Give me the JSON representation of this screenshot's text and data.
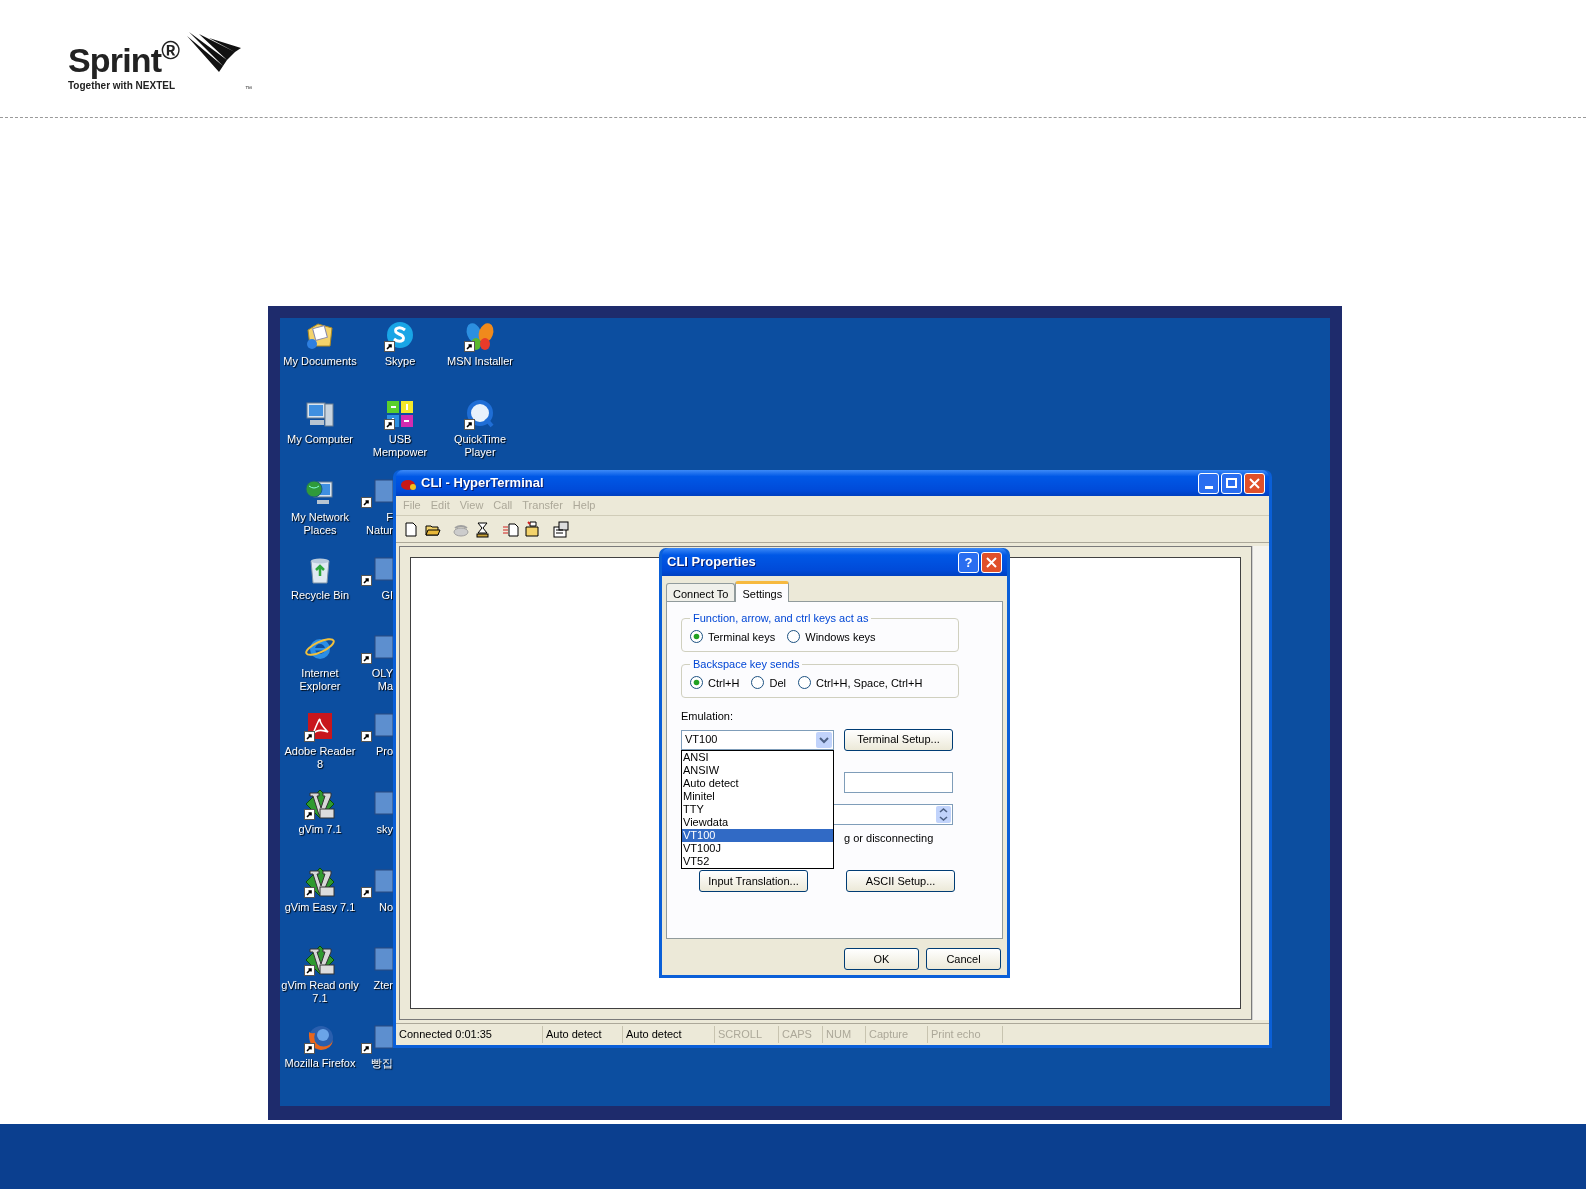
{
  "logo": {
    "name": "Sprint$^{®}$",
    "tagline": "Together with NEXTEL",
    "tm": "™"
  },
  "desktop": {
    "columns": [
      {
        "icons": [
          {
            "kind": "documents",
            "label": "My Documents",
            "shortcut": false
          },
          {
            "kind": "computer",
            "label": "My Computer",
            "shortcut": false
          },
          {
            "kind": "network",
            "label": "My Network Places",
            "shortcut": false
          },
          {
            "kind": "recycle",
            "label": "Recycle Bin",
            "shortcut": false
          },
          {
            "kind": "ie",
            "label": "Internet Explorer",
            "shortcut": false
          },
          {
            "kind": "adobe",
            "label": "Adobe Reader 8",
            "shortcut": true
          },
          {
            "kind": "vim",
            "label": "gVim 7.1",
            "shortcut": true
          },
          {
            "kind": "vim",
            "label": "gVim Easy 7.1",
            "shortcut": true
          },
          {
            "kind": "vim",
            "label": "gVim Read only 7.1",
            "shortcut": true
          },
          {
            "kind": "firefox",
            "label": "Mozilla Firefox",
            "shortcut": true
          }
        ]
      },
      {
        "icons": [
          {
            "kind": "skype",
            "label": "Skype",
            "shortcut": true
          },
          {
            "kind": "usb",
            "label": "USB Mempower",
            "shortcut": true
          },
          {
            "kind": "partial",
            "label": "F Natur",
            "shortcut": true
          },
          {
            "kind": "partial",
            "label": "GI",
            "shortcut": true
          },
          {
            "kind": "partial",
            "label": "OLY Ma",
            "shortcut": true
          },
          {
            "kind": "partial",
            "label": "Pro",
            "shortcut": true
          },
          {
            "kind": "partial",
            "label": "sky",
            "shortcut": false
          },
          {
            "kind": "partial",
            "label": "No",
            "shortcut": true
          },
          {
            "kind": "partial",
            "label": "Zter",
            "shortcut": false
          },
          {
            "kind": "partial",
            "label": "빵집",
            "shortcut": true
          }
        ]
      },
      {
        "icons": [
          {
            "kind": "msn",
            "label": "MSN Installer",
            "shortcut": true
          },
          {
            "kind": "quicktime",
            "label": "QuickTime Player",
            "shortcut": true
          }
        ]
      }
    ]
  },
  "window": {
    "title": "CLI - HyperTerminal",
    "menu": [
      {
        "label": "File",
        "disabled": true
      },
      {
        "label": "Edit",
        "disabled": true
      },
      {
        "label": "View",
        "disabled": true
      },
      {
        "label": "Call",
        "disabled": true
      },
      {
        "label": "Transfer",
        "disabled": true
      },
      {
        "label": "Help",
        "disabled": true
      }
    ],
    "toolbar": [
      {
        "disabled": false
      },
      {
        "disabled": false
      },
      {
        "disabled": true
      },
      {
        "disabled": false
      },
      {
        "disabled": false
      },
      {
        "disabled": false
      },
      {
        "disabled": false
      }
    ],
    "status_bar": [
      {
        "text": "Connected 0:01:35",
        "disabled": false
      },
      {
        "text": "Auto detect",
        "disabled": false
      },
      {
        "text": "Auto detect",
        "disabled": false
      },
      {
        "text": "SCROLL",
        "disabled": true
      },
      {
        "text": "CAPS",
        "disabled": true
      },
      {
        "text": "NUM",
        "disabled": true
      },
      {
        "text": "Capture",
        "disabled": true
      },
      {
        "text": "Print echo",
        "disabled": true
      }
    ]
  },
  "dialog": {
    "title": "CLI Properties",
    "help": "?",
    "tabs": [
      {
        "label": "Connect To",
        "selected": false
      },
      {
        "label": "Settings",
        "selected": true
      }
    ],
    "groups": [
      {
        "legend": "Function, arrow, and ctrl keys act as",
        "options": [
          {
            "label": "Terminal keys",
            "selected": true
          },
          {
            "label": "Windows keys",
            "selected": false
          }
        ]
      },
      {
        "legend": "Backspace key sends",
        "options": [
          {
            "label": "Ctrl+H",
            "selected": true
          },
          {
            "label": "Del",
            "selected": false
          },
          {
            "label": "Ctrl+H, Space, Ctrl+H",
            "selected": false
          }
        ]
      }
    ],
    "emulation": {
      "label": "Emulation:",
      "value": "VT100",
      "setup_button": "Terminal Setup...",
      "options": [
        {
          "label": "ANSI",
          "selected": false
        },
        {
          "label": "ANSIW",
          "selected": false
        },
        {
          "label": "Auto detect",
          "selected": false
        },
        {
          "label": "Minitel",
          "selected": false
        },
        {
          "label": "TTY",
          "selected": false
        },
        {
          "label": "Viewdata",
          "selected": false
        },
        {
          "label": "VT100",
          "selected": true
        },
        {
          "label": "VT100J",
          "selected": false
        },
        {
          "label": "VT52",
          "selected": false
        }
      ]
    },
    "covered_text": "g or disconnecting",
    "buttons": [
      "Input Translation...",
      "ASCII Setup..."
    ],
    "footer_buttons": [
      "OK",
      "Cancel"
    ]
  }
}
